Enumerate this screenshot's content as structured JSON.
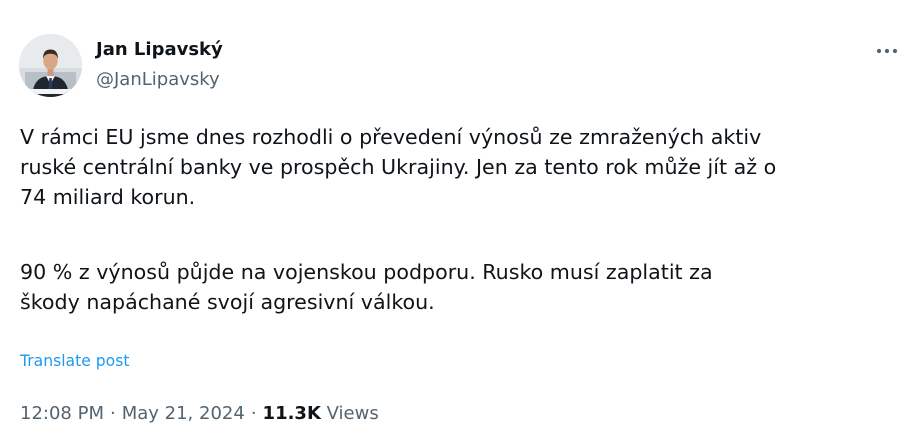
{
  "author": {
    "display_name": "Jan Lipavský",
    "handle": "@JanLipavsky",
    "avatar_icon": "person-portrait-avatar"
  },
  "post": {
    "lines": [
      "V rámci EU jsme dnes rozhodli o převedení výnosů ze zmražených aktiv",
      "ruské centrální banky ve prospěch Ukrajiny. Jen za tento rok může jít až o",
      "74 miliard korun.",
      "90 % z výnosů půjde na vojenskou podporu. Rusko musí zaplatit za",
      "škody napáchané svojí agresivní válkou."
    ],
    "translate_label": "Translate post"
  },
  "meta": {
    "time": "12:08 PM",
    "separator": "·",
    "date": "May 21, 2024",
    "views_count": "11.3K",
    "views_label": "Views"
  },
  "icons": {
    "more": "more-horizontal-icon"
  },
  "colors": {
    "text": "#0f1419",
    "secondary": "#536471",
    "link": "#1d9bf0",
    "background": "#ffffff"
  }
}
